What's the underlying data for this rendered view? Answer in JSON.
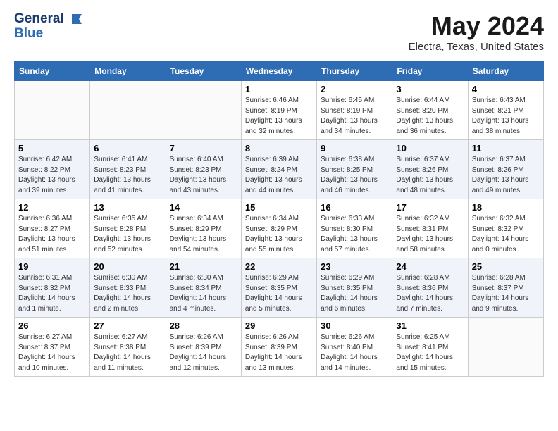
{
  "header": {
    "logo_line1": "General",
    "logo_line2": "Blue",
    "month": "May 2024",
    "location": "Electra, Texas, United States"
  },
  "weekdays": [
    "Sunday",
    "Monday",
    "Tuesday",
    "Wednesday",
    "Thursday",
    "Friday",
    "Saturday"
  ],
  "weeks": [
    [
      {
        "day": "",
        "sunrise": "",
        "sunset": "",
        "daylight": ""
      },
      {
        "day": "",
        "sunrise": "",
        "sunset": "",
        "daylight": ""
      },
      {
        "day": "",
        "sunrise": "",
        "sunset": "",
        "daylight": ""
      },
      {
        "day": "1",
        "sunrise": "Sunrise: 6:46 AM",
        "sunset": "Sunset: 8:19 PM",
        "daylight": "Daylight: 13 hours and 32 minutes."
      },
      {
        "day": "2",
        "sunrise": "Sunrise: 6:45 AM",
        "sunset": "Sunset: 8:19 PM",
        "daylight": "Daylight: 13 hours and 34 minutes."
      },
      {
        "day": "3",
        "sunrise": "Sunrise: 6:44 AM",
        "sunset": "Sunset: 8:20 PM",
        "daylight": "Daylight: 13 hours and 36 minutes."
      },
      {
        "day": "4",
        "sunrise": "Sunrise: 6:43 AM",
        "sunset": "Sunset: 8:21 PM",
        "daylight": "Daylight: 13 hours and 38 minutes."
      }
    ],
    [
      {
        "day": "5",
        "sunrise": "Sunrise: 6:42 AM",
        "sunset": "Sunset: 8:22 PM",
        "daylight": "Daylight: 13 hours and 39 minutes."
      },
      {
        "day": "6",
        "sunrise": "Sunrise: 6:41 AM",
        "sunset": "Sunset: 8:23 PM",
        "daylight": "Daylight: 13 hours and 41 minutes."
      },
      {
        "day": "7",
        "sunrise": "Sunrise: 6:40 AM",
        "sunset": "Sunset: 8:23 PM",
        "daylight": "Daylight: 13 hours and 43 minutes."
      },
      {
        "day": "8",
        "sunrise": "Sunrise: 6:39 AM",
        "sunset": "Sunset: 8:24 PM",
        "daylight": "Daylight: 13 hours and 44 minutes."
      },
      {
        "day": "9",
        "sunrise": "Sunrise: 6:38 AM",
        "sunset": "Sunset: 8:25 PM",
        "daylight": "Daylight: 13 hours and 46 minutes."
      },
      {
        "day": "10",
        "sunrise": "Sunrise: 6:37 AM",
        "sunset": "Sunset: 8:26 PM",
        "daylight": "Daylight: 13 hours and 48 minutes."
      },
      {
        "day": "11",
        "sunrise": "Sunrise: 6:37 AM",
        "sunset": "Sunset: 8:26 PM",
        "daylight": "Daylight: 13 hours and 49 minutes."
      }
    ],
    [
      {
        "day": "12",
        "sunrise": "Sunrise: 6:36 AM",
        "sunset": "Sunset: 8:27 PM",
        "daylight": "Daylight: 13 hours and 51 minutes."
      },
      {
        "day": "13",
        "sunrise": "Sunrise: 6:35 AM",
        "sunset": "Sunset: 8:28 PM",
        "daylight": "Daylight: 13 hours and 52 minutes."
      },
      {
        "day": "14",
        "sunrise": "Sunrise: 6:34 AM",
        "sunset": "Sunset: 8:29 PM",
        "daylight": "Daylight: 13 hours and 54 minutes."
      },
      {
        "day": "15",
        "sunrise": "Sunrise: 6:34 AM",
        "sunset": "Sunset: 8:29 PM",
        "daylight": "Daylight: 13 hours and 55 minutes."
      },
      {
        "day": "16",
        "sunrise": "Sunrise: 6:33 AM",
        "sunset": "Sunset: 8:30 PM",
        "daylight": "Daylight: 13 hours and 57 minutes."
      },
      {
        "day": "17",
        "sunrise": "Sunrise: 6:32 AM",
        "sunset": "Sunset: 8:31 PM",
        "daylight": "Daylight: 13 hours and 58 minutes."
      },
      {
        "day": "18",
        "sunrise": "Sunrise: 6:32 AM",
        "sunset": "Sunset: 8:32 PM",
        "daylight": "Daylight: 14 hours and 0 minutes."
      }
    ],
    [
      {
        "day": "19",
        "sunrise": "Sunrise: 6:31 AM",
        "sunset": "Sunset: 8:32 PM",
        "daylight": "Daylight: 14 hours and 1 minute."
      },
      {
        "day": "20",
        "sunrise": "Sunrise: 6:30 AM",
        "sunset": "Sunset: 8:33 PM",
        "daylight": "Daylight: 14 hours and 2 minutes."
      },
      {
        "day": "21",
        "sunrise": "Sunrise: 6:30 AM",
        "sunset": "Sunset: 8:34 PM",
        "daylight": "Daylight: 14 hours and 4 minutes."
      },
      {
        "day": "22",
        "sunrise": "Sunrise: 6:29 AM",
        "sunset": "Sunset: 8:35 PM",
        "daylight": "Daylight: 14 hours and 5 minutes."
      },
      {
        "day": "23",
        "sunrise": "Sunrise: 6:29 AM",
        "sunset": "Sunset: 8:35 PM",
        "daylight": "Daylight: 14 hours and 6 minutes."
      },
      {
        "day": "24",
        "sunrise": "Sunrise: 6:28 AM",
        "sunset": "Sunset: 8:36 PM",
        "daylight": "Daylight: 14 hours and 7 minutes."
      },
      {
        "day": "25",
        "sunrise": "Sunrise: 6:28 AM",
        "sunset": "Sunset: 8:37 PM",
        "daylight": "Daylight: 14 hours and 9 minutes."
      }
    ],
    [
      {
        "day": "26",
        "sunrise": "Sunrise: 6:27 AM",
        "sunset": "Sunset: 8:37 PM",
        "daylight": "Daylight: 14 hours and 10 minutes."
      },
      {
        "day": "27",
        "sunrise": "Sunrise: 6:27 AM",
        "sunset": "Sunset: 8:38 PM",
        "daylight": "Daylight: 14 hours and 11 minutes."
      },
      {
        "day": "28",
        "sunrise": "Sunrise: 6:26 AM",
        "sunset": "Sunset: 8:39 PM",
        "daylight": "Daylight: 14 hours and 12 minutes."
      },
      {
        "day": "29",
        "sunrise": "Sunrise: 6:26 AM",
        "sunset": "Sunset: 8:39 PM",
        "daylight": "Daylight: 14 hours and 13 minutes."
      },
      {
        "day": "30",
        "sunrise": "Sunrise: 6:26 AM",
        "sunset": "Sunset: 8:40 PM",
        "daylight": "Daylight: 14 hours and 14 minutes."
      },
      {
        "day": "31",
        "sunrise": "Sunrise: 6:25 AM",
        "sunset": "Sunset: 8:41 PM",
        "daylight": "Daylight: 14 hours and 15 minutes."
      },
      {
        "day": "",
        "sunrise": "",
        "sunset": "",
        "daylight": ""
      }
    ]
  ]
}
